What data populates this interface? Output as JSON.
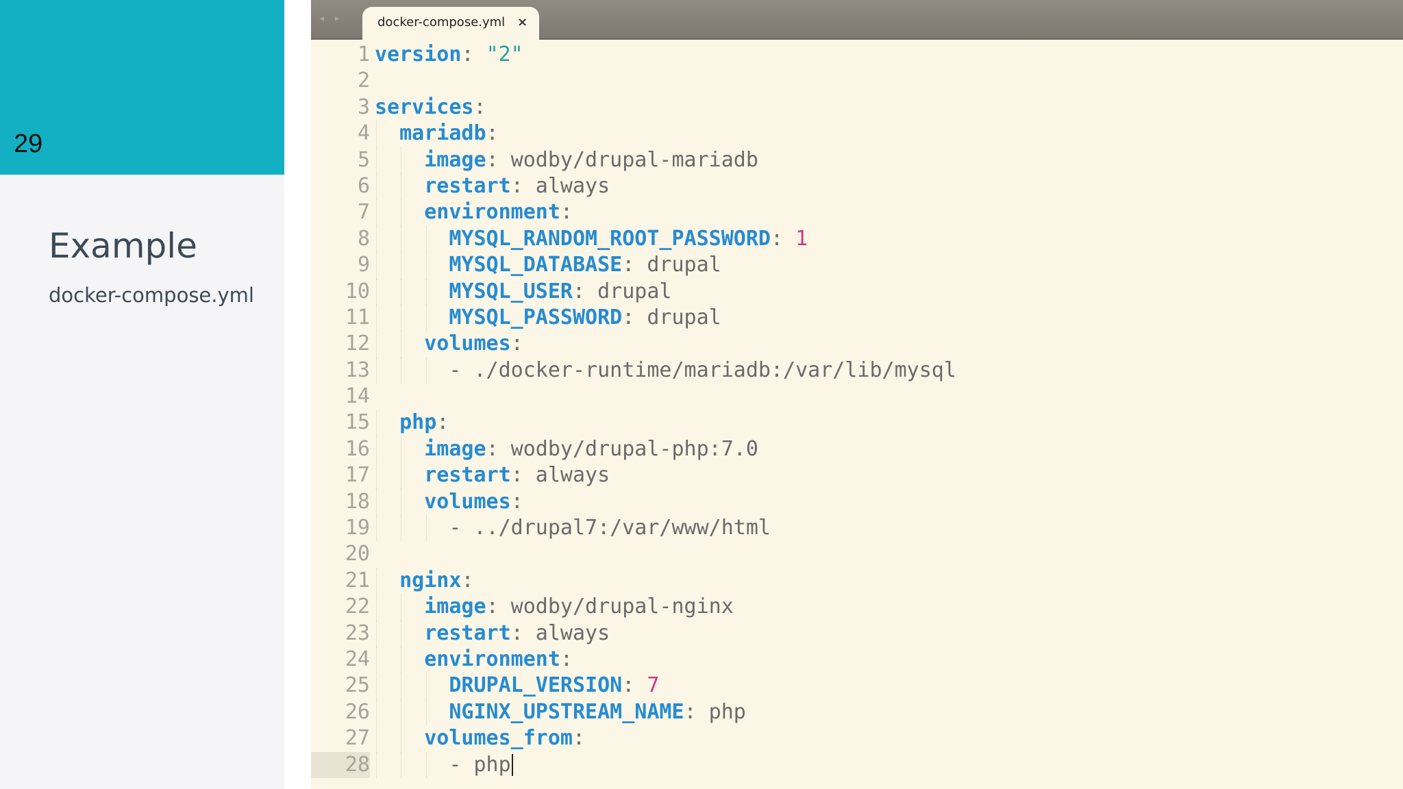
{
  "slide": {
    "number": "29",
    "title": "Example",
    "subtitle": "docker-compose.yml"
  },
  "editor": {
    "tab_label": "docker-compose.yml",
    "tab_close": "×",
    "nav_arrows": "◂ ▸",
    "current_line": 28,
    "lines": [
      [
        [
          "k",
          "version"
        ],
        [
          "p",
          ": "
        ],
        [
          "s",
          "\"2\""
        ]
      ],
      [],
      [
        [
          "k",
          "services"
        ],
        [
          "p",
          ":"
        ]
      ],
      [
        [
          "i",
          "  "
        ],
        [
          "k",
          "mariadb"
        ],
        [
          "p",
          ":"
        ]
      ],
      [
        [
          "i",
          "    "
        ],
        [
          "k",
          "image"
        ],
        [
          "p",
          ": wodby/drupal-mariadb"
        ]
      ],
      [
        [
          "i",
          "    "
        ],
        [
          "k",
          "restart"
        ],
        [
          "p",
          ": always"
        ]
      ],
      [
        [
          "i",
          "    "
        ],
        [
          "k",
          "environment"
        ],
        [
          "p",
          ":"
        ]
      ],
      [
        [
          "i",
          "      "
        ],
        [
          "k",
          "MYSQL_RANDOM_ROOT_PASSWORD"
        ],
        [
          "p",
          ": "
        ],
        [
          "n",
          "1"
        ]
      ],
      [
        [
          "i",
          "      "
        ],
        [
          "k",
          "MYSQL_DATABASE"
        ],
        [
          "p",
          ": drupal"
        ]
      ],
      [
        [
          "i",
          "      "
        ],
        [
          "k",
          "MYSQL_USER"
        ],
        [
          "p",
          ": drupal"
        ]
      ],
      [
        [
          "i",
          "      "
        ],
        [
          "k",
          "MYSQL_PASSWORD"
        ],
        [
          "p",
          ": drupal"
        ]
      ],
      [
        [
          "i",
          "    "
        ],
        [
          "k",
          "volumes"
        ],
        [
          "p",
          ":"
        ]
      ],
      [
        [
          "i",
          "      "
        ],
        [
          "p",
          "- ./docker-runtime/mariadb:/var/lib/mysql"
        ]
      ],
      [],
      [
        [
          "i",
          "  "
        ],
        [
          "k",
          "php"
        ],
        [
          "p",
          ":"
        ]
      ],
      [
        [
          "i",
          "    "
        ],
        [
          "k",
          "image"
        ],
        [
          "p",
          ": wodby/drupal-php:7.0"
        ]
      ],
      [
        [
          "i",
          "    "
        ],
        [
          "k",
          "restart"
        ],
        [
          "p",
          ": always"
        ]
      ],
      [
        [
          "i",
          "    "
        ],
        [
          "k",
          "volumes"
        ],
        [
          "p",
          ":"
        ]
      ],
      [
        [
          "i",
          "      "
        ],
        [
          "p",
          "- ../drupal7:/var/www/html"
        ]
      ],
      [],
      [
        [
          "i",
          "  "
        ],
        [
          "k",
          "nginx"
        ],
        [
          "p",
          ":"
        ]
      ],
      [
        [
          "i",
          "    "
        ],
        [
          "k",
          "image"
        ],
        [
          "p",
          ": wodby/drupal-nginx"
        ]
      ],
      [
        [
          "i",
          "    "
        ],
        [
          "k",
          "restart"
        ],
        [
          "p",
          ": always"
        ]
      ],
      [
        [
          "i",
          "    "
        ],
        [
          "k",
          "environment"
        ],
        [
          "p",
          ":"
        ]
      ],
      [
        [
          "i",
          "      "
        ],
        [
          "k",
          "DRUPAL_VERSION"
        ],
        [
          "p",
          ": "
        ],
        [
          "n",
          "7"
        ]
      ],
      [
        [
          "i",
          "      "
        ],
        [
          "k",
          "NGINX_UPSTREAM_NAME"
        ],
        [
          "p",
          ": php"
        ]
      ],
      [
        [
          "i",
          "    "
        ],
        [
          "k",
          "volumes_from"
        ],
        [
          "p",
          ":"
        ]
      ],
      [
        [
          "i",
          "      "
        ],
        [
          "p",
          "- php"
        ]
      ]
    ]
  }
}
